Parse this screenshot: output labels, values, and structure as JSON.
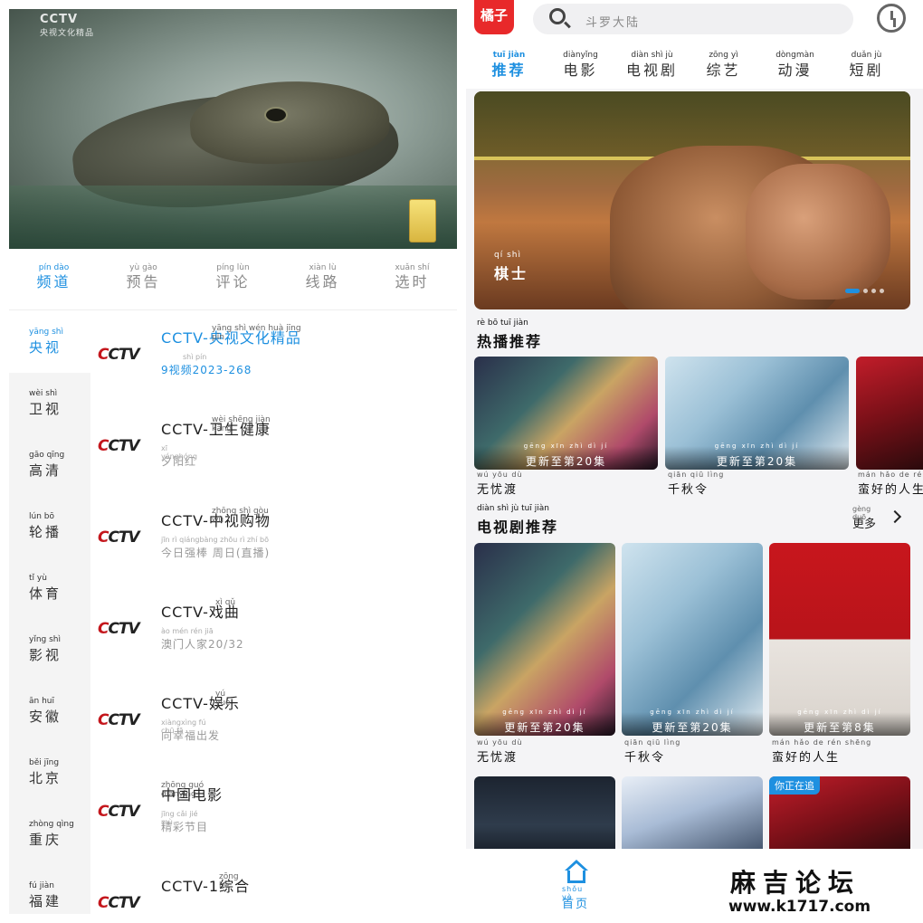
{
  "left": {
    "video": {
      "watermark": "CCTV",
      "watermark_sub": "央视文化精品"
    },
    "tabs": [
      {
        "py": "pín dào",
        "zh": "频道",
        "active": true
      },
      {
        "py": "yù gào",
        "zh": "预告"
      },
      {
        "py": "píng lùn",
        "zh": "评论"
      },
      {
        "py": "xiàn lù",
        "zh": "线路"
      },
      {
        "py": "xuǎn shí",
        "zh": "选时"
      }
    ],
    "categories": [
      {
        "py": "yāng shì",
        "zh": "央视",
        "active": true
      },
      {
        "py": "wèi shì",
        "zh": "卫视"
      },
      {
        "py": "gāo qīng",
        "zh": "高清"
      },
      {
        "py": "lún bō",
        "zh": "轮播"
      },
      {
        "py": "tǐ yù",
        "zh": "体育"
      },
      {
        "py": "yǐng shì",
        "zh": "影视"
      },
      {
        "py": "ān huī",
        "zh": "安徽"
      },
      {
        "py": "běi jīng",
        "zh": "北京"
      },
      {
        "py": "zhòng qìng",
        "zh": "重庆"
      },
      {
        "py": "fú jiàn",
        "zh": "福建"
      }
    ],
    "channels": [
      {
        "logo": "CCTV",
        "name": "CCTV-央视文化精品",
        "name_py": "yāng shì wén huà jīng pǐn",
        "program": "9视频2023-268",
        "program_py": "shì pín",
        "active": true
      },
      {
        "logo": "CCTV",
        "name": "CCTV-卫生健康",
        "name_py": "wèi shēng jiàn kāng",
        "program": "夕阳红",
        "program_py": "xī yánghóng"
      },
      {
        "logo": "CCTV",
        "name": "CCTV-中视购物",
        "name_py": "zhōng shì gòu wù",
        "program": "今日强棒 周日(直播)",
        "program_py": "jīn rì qiángbàng zhōu rì zhí bō"
      },
      {
        "logo": "CCTV",
        "name": "CCTV-戏曲",
        "name_py": "xì qǔ",
        "program": "澳门人家20/32",
        "program_py": "ào mén rén jiā"
      },
      {
        "logo": "CCTV",
        "name": "CCTV-娱乐",
        "name_py": "yú yuè",
        "program": "向幸福出发",
        "program_py": "xiàngxìng fú chū fā"
      },
      {
        "logo": "CCTV",
        "name": "中国电影",
        "name_py": "zhōng guó diànyǐng",
        "program": "精彩节目",
        "program_py": "jīng cǎi jié mù"
      },
      {
        "logo": "CCTV",
        "name": "CCTV-1综合",
        "name_py": "zōng hé",
        "program": "",
        "program_py": ""
      }
    ]
  },
  "right": {
    "app_logo": "橘子",
    "search": {
      "placeholder": "斗罗大陆",
      "py": "dǒu luó dà lù"
    },
    "tabs": [
      {
        "py": "tuī jiàn",
        "zh": "推荐",
        "active": true
      },
      {
        "py": "diànyǐng",
        "zh": "电影"
      },
      {
        "py": "diàn shì jù",
        "zh": "电视剧"
      },
      {
        "py": "zōng yì",
        "zh": "综艺"
      },
      {
        "py": "dòngmàn",
        "zh": "动漫"
      },
      {
        "py": "duǎn jù",
        "zh": "短剧"
      }
    ],
    "banner": {
      "title": "棋士",
      "title_py": "qí shì",
      "pages": 4,
      "current_page": 1
    },
    "hot": {
      "title": "热播推荐",
      "title_py": "rè bō tuī jiàn",
      "items": [
        {
          "title": "无忧渡",
          "title_py": "wú yōu dù",
          "update": "更新至第20集",
          "update_py": "gēng xīn zhì dì jí"
        },
        {
          "title": "千秋令",
          "title_py": "qiān qiū lìng",
          "update": "更新至第20集",
          "update_py": "gēng xīn zhì dì jí"
        },
        {
          "title": "蛮好的人生",
          "title_py": "mán hǎo de rén",
          "update": "",
          "update_py": ""
        }
      ]
    },
    "tv": {
      "title": "电视剧推荐",
      "title_py": "diàn shì jù tuī jiàn",
      "more": "更多",
      "more_py": "gèng duō",
      "items": [
        {
          "title": "无忧渡",
          "title_py": "wú yōu dù",
          "update": "更新至第20集",
          "update_py": "gēng xīn zhì dì jí"
        },
        {
          "title": "千秋令",
          "title_py": "qiān qiū lìng",
          "update": "更新至第20集",
          "update_py": "gēng xīn zhì dì jí"
        },
        {
          "title": "蛮好的人生",
          "title_py": "mán hǎo de rén shēng",
          "update": "更新至第8集",
          "update_py": "gēng xīn zhì dì jí"
        }
      ],
      "row2_tags": [
        "",
        "",
        "你正在追"
      ],
      "row2_tags_py": [
        "",
        "",
        "nǐ zhèng zài zhuī"
      ]
    },
    "nav": {
      "home": "首页",
      "home_py": "shǒu yè"
    },
    "site": {
      "name": "麻吉论坛",
      "url": "www.k1717.com"
    }
  }
}
